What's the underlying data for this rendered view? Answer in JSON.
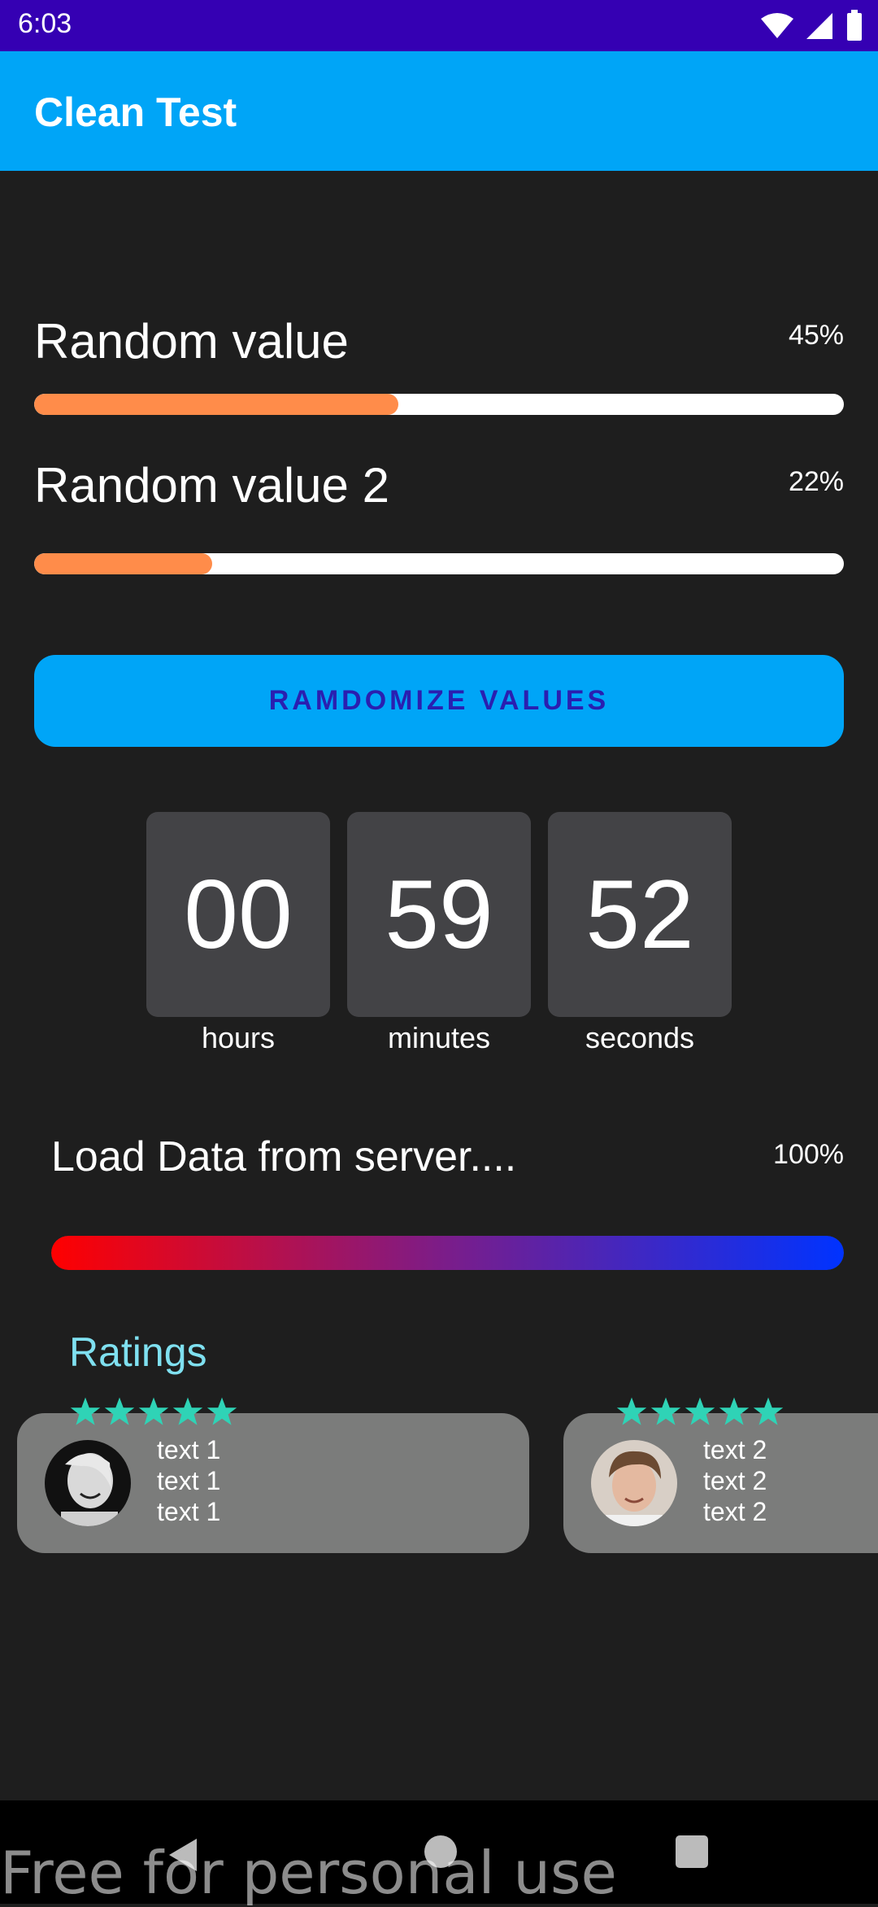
{
  "status_bar": {
    "time": "6:03",
    "icons": [
      "wifi-icon",
      "signal-icon",
      "battery-icon"
    ]
  },
  "app_bar": {
    "title": "Clean Test"
  },
  "progress_rows": [
    {
      "label": "Random value",
      "percent_text": "45%",
      "value": 0.45
    },
    {
      "label": "Random value 2",
      "percent_text": "22%",
      "value": 0.22
    }
  ],
  "randomize_button": {
    "label": "RAMDOMIZE VALUES"
  },
  "countdown": {
    "hours": "00",
    "minutes": "59",
    "seconds": "52",
    "hours_label": "hours",
    "minutes_label": "minutes",
    "seconds_label": "seconds"
  },
  "load": {
    "label": "Load Data from server....",
    "percent_text": "100%",
    "value": 1.0
  },
  "ratings": {
    "title": "Ratings",
    "cards": [
      {
        "stars": 5,
        "lines": [
          "text 1",
          "text 1",
          "text 1"
        ]
      },
      {
        "stars": 5,
        "lines": [
          "text 2",
          "text 2",
          "text 2"
        ]
      }
    ]
  },
  "watermark": "Free for personal use",
  "colors": {
    "status_bar": "#3500b3",
    "app_bar": "#00a5f7",
    "accent_orange": "#ff8c4a",
    "star": "#2fd3b6",
    "ratings_title": "#7fe0f0",
    "card": "#7b7c7b"
  }
}
